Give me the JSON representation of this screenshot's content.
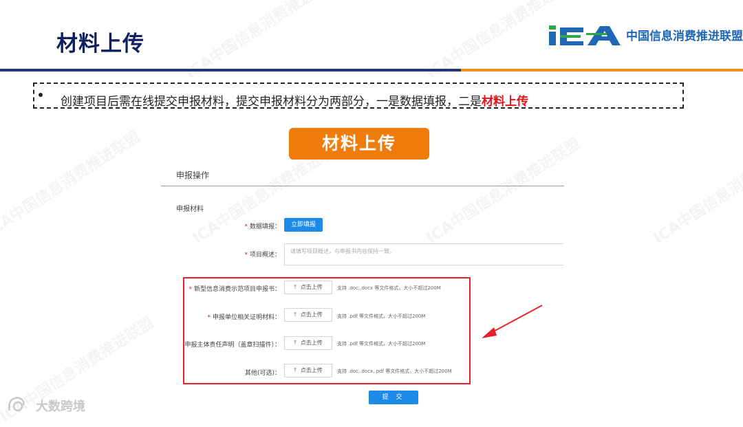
{
  "slide": {
    "title": "材料上传",
    "logo_text": "中国信息消费推进联盟",
    "bullet_text": "创建项目后需在线提交申报材料，提交申报材料分为两部分，一是数据填报，二是",
    "bullet_highlight": "材料上传",
    "badge_label": "材料上传",
    "colors": {
      "title": "#10205e",
      "accent_orange": "#f07c0c",
      "accent_blue": "#1e8ae8",
      "highlight_red": "#e8101a"
    }
  },
  "form": {
    "section_title": "申报操作",
    "materials_label": "申报材料",
    "data_fill_label": "数据填报：",
    "data_fill_button": "立即填报",
    "summary_label": "项目概述：",
    "summary_placeholder": "请填写项目概述，与申报书内容保持一致。",
    "uploads": [
      {
        "label": "新型信息消费示范项目申报书：",
        "required": "*",
        "button": "点击上传",
        "hint": "支持 .doc,.docx 等文件格式，大小不超过200M"
      },
      {
        "label": "申报单位相关证明材料：",
        "required": "*",
        "button": "点击上传",
        "hint": "支持 .pdf 等文件格式，大小不超过200M"
      },
      {
        "label": "申报主体责任声明（盖章扫描件）：",
        "required": "",
        "button": "点击上传",
        "hint": "支持 .pdf 等文件格式，大小不超过200M"
      },
      {
        "label": "其他(可选)：",
        "required": "",
        "button": "点击上传",
        "hint": "支持 .doc,.docx,.pdf 等文件格式，大小不超过200M"
      }
    ],
    "submit_label": "提 交",
    "required_mark": "*"
  },
  "watermarks": [
    "ICA中国信息消费推进联盟",
    "ICA中国信息消费推进联盟",
    "ICA中国信息消费推进联盟",
    "ICA中国信息消费推进联盟",
    "ICA中国信息消费推进联盟",
    "ICA中国信息消费推进联盟",
    "ICA中国信息消费推进联盟"
  ],
  "footer": {
    "brand_text": "大数跨境"
  }
}
